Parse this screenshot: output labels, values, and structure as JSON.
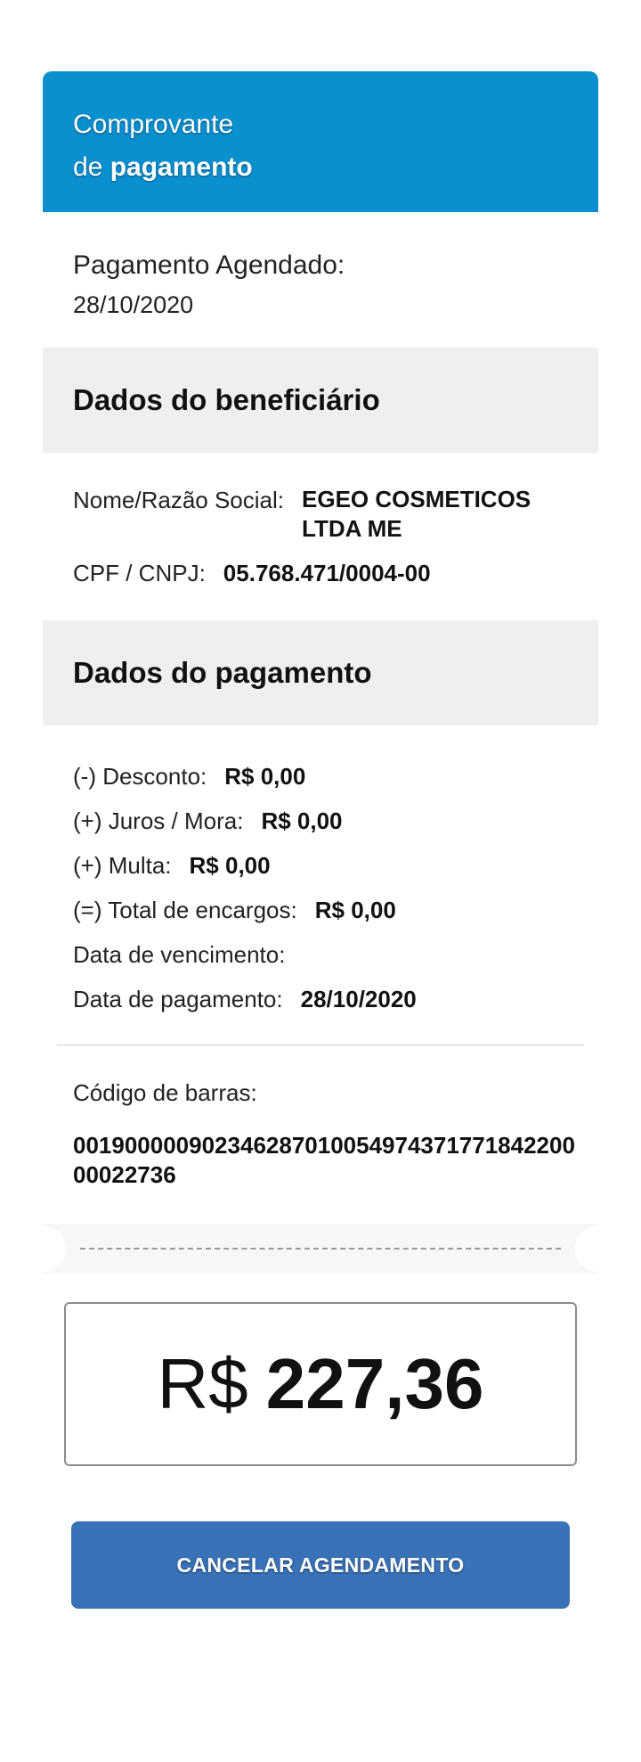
{
  "header": {
    "line1": "Comprovante",
    "line2_prefix": "de",
    "line2_strong": "pagamento"
  },
  "scheduled": {
    "label": "Pagamento Agendado:",
    "date": "28/10/2020"
  },
  "beneficiary": {
    "title": "Dados do beneficiário",
    "name_label": "Nome/Razão Social:",
    "name_value": "EGEO COSMETICOS LTDA ME",
    "doc_label": "CPF / CNPJ:",
    "doc_value": "05.768.471/0004-00"
  },
  "payment": {
    "title": "Dados do pagamento",
    "discount_label": "(-) Desconto:",
    "discount_value": "R$ 0,00",
    "interest_label": "(+) Juros / Mora:",
    "interest_value": "R$ 0,00",
    "fine_label": "(+) Multa:",
    "fine_value": "R$ 0,00",
    "charges_label": "(=) Total de encargos:",
    "charges_value": "R$ 0,00",
    "due_label": "Data de vencimento:",
    "due_value": "",
    "paid_label": "Data de pagamento:",
    "paid_value": "28/10/2020"
  },
  "barcode": {
    "label": "Código de barras:",
    "code": "00190000090234628701005497437177184220000022736"
  },
  "amount": {
    "currency": "R$",
    "value": "227,36"
  },
  "actions": {
    "cancel_label": "CANCELAR AGENDAMENTO"
  },
  "colors": {
    "header": "#0a8fcf",
    "section_bg": "#efefef",
    "button": "#3a72b8"
  }
}
